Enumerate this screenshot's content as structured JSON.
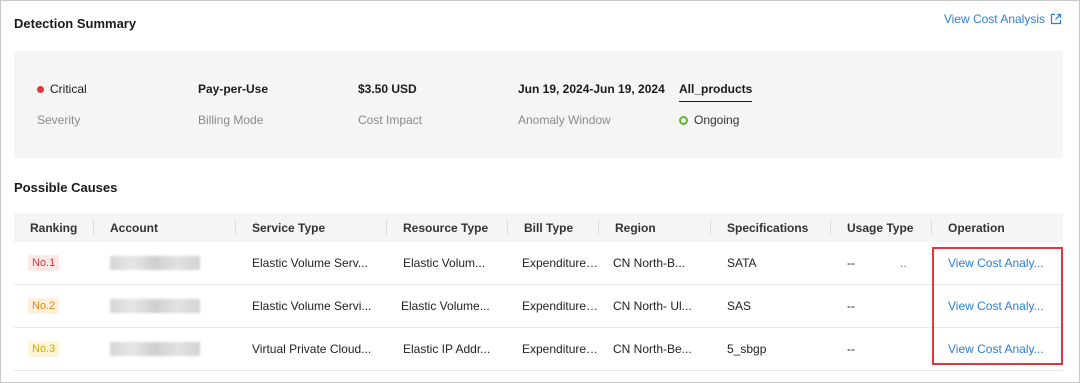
{
  "detection": {
    "title": "Detection Summary",
    "link_label": "View Cost Analysis"
  },
  "summary": {
    "severity_value": "Critical",
    "severity_label": "Severity",
    "billing_value": "Pay-per-Use",
    "billing_label": "Billing Mode",
    "cost_value": "$3.50 USD",
    "cost_label": "Cost Impact",
    "window_value": "Jun 19, 2024-Jun 19, 2024",
    "window_label": "Anomaly Window",
    "products": "All_products",
    "status": "Ongoing"
  },
  "causes": {
    "title": "Possible Causes",
    "columns": [
      "Ranking",
      "Account",
      "Service Type",
      "Resource Type",
      "Bill Type",
      "Region",
      "Specifications",
      "Usage Type",
      "Operation"
    ],
    "rows": [
      {
        "rank": "No.1",
        "service": "Elastic Volume Serv...",
        "resource": "Elastic Volum...",
        "bill": "Expenditure-...",
        "region": "CN North-B...",
        "spec": "SATA",
        "usage": "--",
        "usage_extra": "..",
        "operation": "View Cost Analy..."
      },
      {
        "rank": "No.2",
        "service": "Elastic Volume Servi...",
        "resource": "Elastic Volume...",
        "bill": "Expenditure-...",
        "region": "CN North- Ul...",
        "spec": "SAS",
        "usage": "--",
        "usage_extra": "",
        "operation": "View Cost Analy..."
      },
      {
        "rank": "No.3",
        "service": "Virtual Private Cloud...",
        "resource": "Elastic IP Addr...",
        "bill": "Expenditure-...",
        "region": "CN North-Be...",
        "spec": "5_sbgp",
        "usage": "--",
        "usage_extra": "",
        "operation": "View Cost Analy..."
      }
    ]
  },
  "colors": {
    "link": "#2a7fd4",
    "critical": "#e0363f",
    "ongoing": "#5cb82a",
    "rank1_bg": "#fde8e8",
    "rank1_fg": "#e0363f",
    "rank2_bg": "#fdf0dc",
    "rank2_fg": "#e8850c",
    "rank3_bg": "#fdf6d6",
    "rank3_fg": "#d9a400",
    "highlight": "#e0363f"
  },
  "icons": {
    "external_link": "external-link-icon",
    "severity_dot": "critical-dot-icon",
    "status_ring": "ongoing-status-icon"
  }
}
